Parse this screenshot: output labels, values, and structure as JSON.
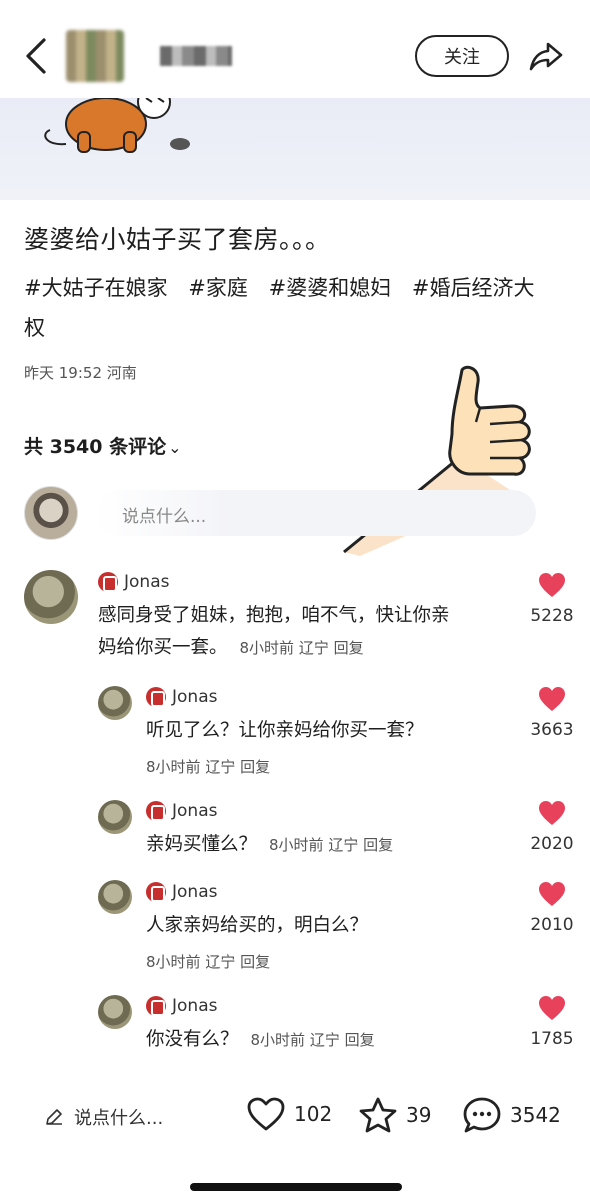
{
  "topbar": {
    "follow_label": "关注"
  },
  "post": {
    "title": "婆婆给小姑子买了套房。。。",
    "tags": [
      "#大姑子在娘家",
      "#家庭",
      "#婆婆和媳妇",
      "#婚后经济大权"
    ],
    "meta": "昨天 19:52 河南"
  },
  "comments_header": {
    "count_label": "共 3540 条评论",
    "chevron": "⌄"
  },
  "my_comment": {
    "placeholder": "说点什么..."
  },
  "comments": [
    {
      "user": "Jonas",
      "text_line1": "感同身受了姐妹，抱抱，咱不气，快让你亲",
      "text_line2": "妈给你买一套。",
      "time": "8小时前",
      "location": "辽宁",
      "reply": "回复",
      "likes": "5228"
    },
    {
      "user": "Jonas",
      "text": "听见了么？让你亲妈给你买一套？",
      "time": "8小时前",
      "location": "辽宁",
      "reply": "回复",
      "likes": "3663"
    },
    {
      "user": "Jonas",
      "text": "亲妈买懂么？",
      "time": "8小时前",
      "location": "辽宁",
      "reply": "回复",
      "likes": "2020"
    },
    {
      "user": "Jonas",
      "text": "人家亲妈给买的，明白么？",
      "time": "8小时前",
      "location": "辽宁",
      "reply": "回复",
      "likes": "2010"
    },
    {
      "user": "Jonas",
      "text": "你没有么？",
      "time": "8小时前",
      "location": "辽宁",
      "reply": "回复",
      "likes": "1785"
    }
  ],
  "bottombar": {
    "input_label": "说点什么...",
    "like_count": "102",
    "star_count": "39",
    "comment_count": "3542"
  },
  "colors": {
    "heart": "#e8415b",
    "badge": "#c72e2e"
  }
}
